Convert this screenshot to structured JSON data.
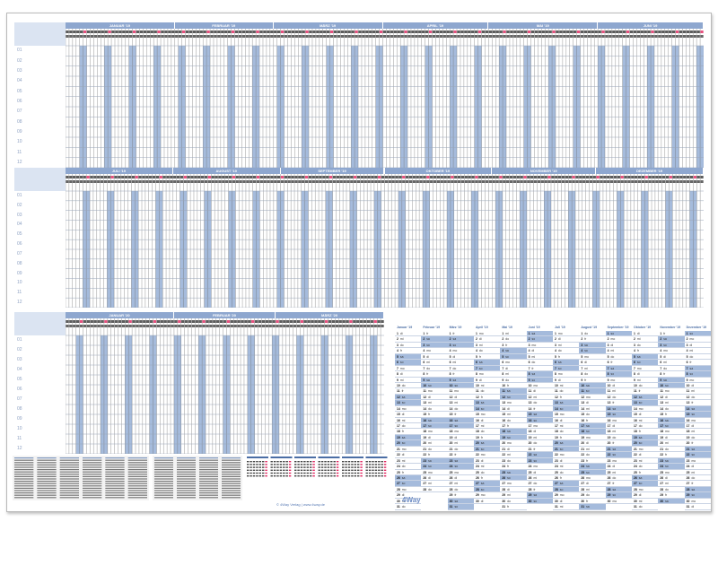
{
  "planners": [
    {
      "id": "p1",
      "months": [
        "JANUAR '19",
        "FEBRUAR '19",
        "MÄRZ '19",
        "APRIL '19",
        "MAI '19",
        "JUNI '19"
      ]
    },
    {
      "id": "p2",
      "months": [
        "JULI '19",
        "AUGUST '19",
        "SEPTEMBER '19",
        "OKTOBER '19",
        "NOVEMBER '19",
        "DEZEMBER '19"
      ]
    },
    {
      "id": "p3",
      "months": [
        "JANUAR '20",
        "FEBRUAR '20",
        "MÄRZ '20"
      ]
    }
  ],
  "row_labels": [
    "01",
    "02",
    "03",
    "04",
    "05",
    "06",
    "07",
    "08",
    "09",
    "10",
    "11",
    "12"
  ],
  "year_calendar": {
    "months": [
      "Januar '19",
      "Februar '19",
      "März '19",
      "April '19",
      "Mai '19",
      "Juni '19",
      "Juli '19",
      "August '19",
      "September '19",
      "Oktober '19",
      "November '19",
      "Dezember '19"
    ],
    "day_abbr": [
      "mo",
      "di",
      "mi",
      "do",
      "fr",
      "sa",
      "so"
    ]
  },
  "footer": {
    "logo": "4Way",
    "note": "© 4Way Verlag  |  www.4way.de"
  },
  "colors": {
    "accent": "#8ea7cf",
    "weekend": "#a5bbdc",
    "header_label": "#dbe4f2",
    "sunday": "#e0245e"
  }
}
